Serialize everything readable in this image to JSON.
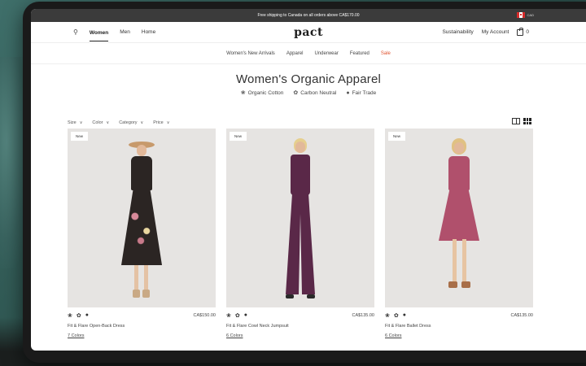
{
  "promo": {
    "text": "Free shipping to Canada on all orders above CA$170.00",
    "region": "CAD"
  },
  "nav": {
    "logo": "pact",
    "left": [
      "Women",
      "Men",
      "Home"
    ],
    "right": [
      "Sustainability",
      "My Account"
    ],
    "cart_count": "0"
  },
  "subnav": [
    "Women's New Arrivals",
    "Apparel",
    "Underwear",
    "Featured",
    "Sale"
  ],
  "heading": {
    "title": "Women's Organic Apparel",
    "badges": [
      "Organic Cotton",
      "Carbon Neutral",
      "Fair Trade"
    ]
  },
  "filters": [
    "Size",
    "Color",
    "Category",
    "Price"
  ],
  "products": [
    {
      "tag": "New",
      "price": "CA$150.00",
      "name": "Fit & Flare Open-Back Dress",
      "colors": "7 Colors",
      "dress_color": "#2b2523"
    },
    {
      "tag": "New",
      "price": "CA$135.00",
      "name": "Fit & Flare Cowl Neck Jumpsuit",
      "colors": "6 Colors",
      "dress_color": "#5a2848"
    },
    {
      "tag": "New",
      "price": "CA$135.00",
      "name": "Fit & Flare Ballet Dress",
      "colors": "6 Colors",
      "dress_color": "#b0506c"
    }
  ],
  "colors": {
    "sale": "#e0532f",
    "promo_bg": "#3b3b3b",
    "device": "#1a1a1a"
  }
}
